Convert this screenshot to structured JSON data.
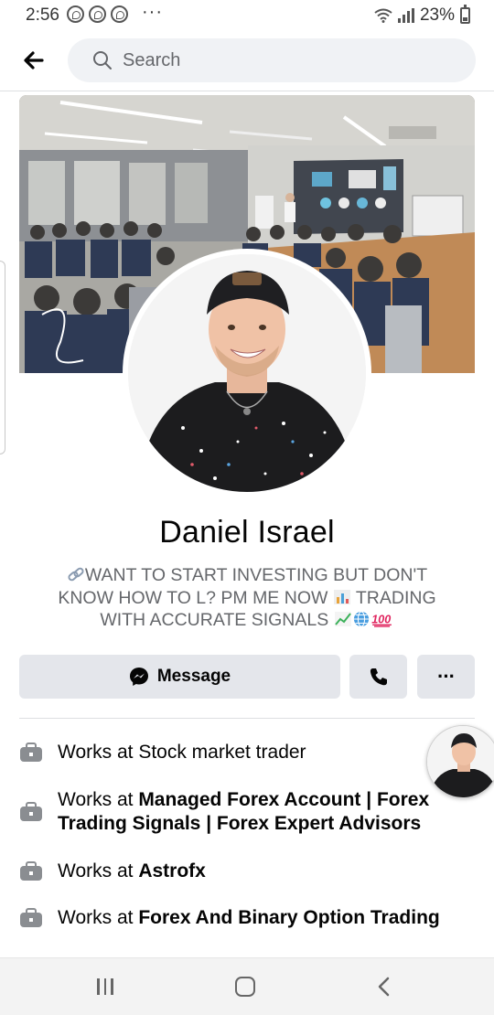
{
  "status_bar": {
    "time": "2:56",
    "overflow": "···",
    "battery": "23%",
    "icons": [
      "viber-icon",
      "viber-icon",
      "viber-icon",
      "wifi-icon",
      "signal-icon",
      "battery-icon"
    ]
  },
  "search": {
    "placeholder": "Search"
  },
  "profile": {
    "name": "Daniel Israel",
    "bio_line1": "WANT TO START INVESTING BUT DON'T",
    "bio_line2": "KNOW HOW TO L? PM ME NOW",
    "bio_line2_tail": "TRADING",
    "bio_line3": "WITH ACCURATE SIGNALS",
    "bio_emoji": [
      "link-emoji",
      "bar-chart-emoji",
      "chart-up-emoji",
      "globe-emoji",
      "hundred-emoji"
    ]
  },
  "actions": {
    "message_label": "Message",
    "call_icon": "phone-icon",
    "more_label": "···"
  },
  "work": [
    {
      "prefix": "Works at",
      "place": "Stock market trader",
      "bold": false
    },
    {
      "prefix": "Works at",
      "place": "Managed Forex Account | Forex Trading Signals | Forex Expert Advisors",
      "bold": true
    },
    {
      "prefix": "Works at",
      "place": "Astrofx",
      "bold": true
    },
    {
      "prefix": "Works at",
      "place": "Forex And Binary Option Trading",
      "bold": true
    }
  ],
  "colors": {
    "page_bg": "#ffffff",
    "button_bg": "#e4e6eb",
    "search_bg": "#f0f2f5",
    "secondary_text": "#65676b",
    "primary_text": "#050505"
  }
}
